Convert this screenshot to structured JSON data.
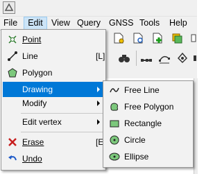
{
  "menubar": {
    "items": [
      "File",
      "Edit",
      "View",
      "Query",
      "GNSS",
      "Tools",
      "Help"
    ],
    "active": "Edit"
  },
  "edit_menu": {
    "items": [
      {
        "label": "Point",
        "icon": "point-icon"
      },
      {
        "label": "Line",
        "shortcut": "[L]",
        "icon": "line-icon"
      },
      {
        "label": "Polygon",
        "icon": "polygon-icon"
      },
      {
        "label": "Drawing",
        "highlighted": true,
        "submenu": true
      },
      {
        "label": "Modify",
        "submenu": true
      },
      {
        "label": "Edit vertex",
        "submenu": true
      },
      {
        "label": "Erase",
        "shortcut": "[E",
        "icon": "erase-icon"
      },
      {
        "label": "Undo",
        "icon": "undo-icon"
      }
    ]
  },
  "drawing_submenu": {
    "items": [
      {
        "label": "Free Line",
        "icon": "free-line-icon"
      },
      {
        "label": "Free Polygon",
        "icon": "free-polygon-icon"
      },
      {
        "label": "Rectangle",
        "icon": "rectangle-icon"
      },
      {
        "label": "Circle",
        "icon": "circle-icon"
      },
      {
        "label": "Ellipse",
        "icon": "ellipse-icon"
      }
    ]
  },
  "colors": {
    "highlight": "#0078d7",
    "menu_bg": "#f2f2f2",
    "menubar_active": "#cce4f7"
  }
}
